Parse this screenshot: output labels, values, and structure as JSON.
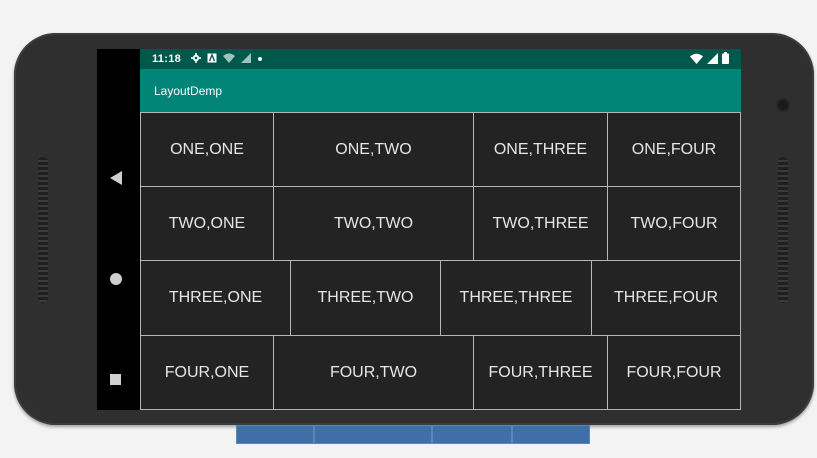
{
  "status_bar": {
    "time": "11:18",
    "icons": [
      "gear-icon",
      "a-icon",
      "wifi-question-icon",
      "signal-question-icon",
      "dot-icon"
    ],
    "right_icons": [
      "wifi-icon",
      "signal-icon",
      "battery-icon"
    ]
  },
  "app_bar": {
    "title": "LayoutDemp"
  },
  "grid": {
    "rows": [
      [
        "ONE,ONE",
        "ONE,TWO",
        "ONE,THREE",
        "ONE,FOUR"
      ],
      [
        "TWO,ONE",
        "TWO,TWO",
        "TWO,THREE",
        "TWO,FOUR"
      ],
      [
        "THREE,ONE",
        "THREE,TWO",
        "THREE,THREE",
        "THREE,FOUR"
      ],
      [
        "FOUR,ONE",
        "FOUR,TWO",
        "FOUR,THREE",
        "FOUR,FOUR"
      ]
    ]
  },
  "nav": {
    "icons": [
      "back-icon",
      "home-icon",
      "recents-icon"
    ]
  },
  "colors": {
    "status_bar": "#00574b",
    "app_bar": "#008577",
    "cell_bg": "#232323",
    "cell_border": "#b5b5b5"
  }
}
